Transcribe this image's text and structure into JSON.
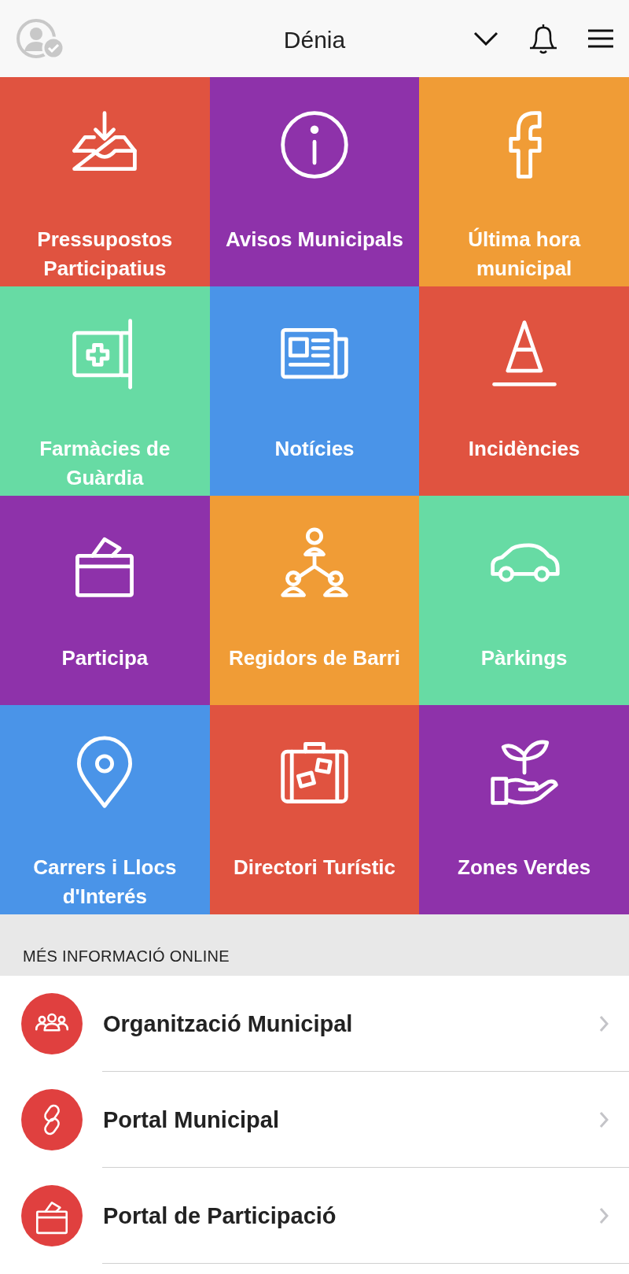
{
  "header": {
    "title": "Dénia"
  },
  "tiles": [
    {
      "label": "Pressupostos Participatius",
      "kind": "inbox",
      "color": "#e05340"
    },
    {
      "label": "Avisos Municipals",
      "kind": "info",
      "color": "#8e32aa"
    },
    {
      "label": "Última hora municipal",
      "kind": "facebook",
      "color": "#f09c36"
    },
    {
      "label": "Farmàcies de Guàrdia",
      "kind": "pharmacy",
      "color": "#67dba4"
    },
    {
      "label": "Notícies",
      "kind": "newspaper",
      "color": "#4a94e8"
    },
    {
      "label": "Incidències",
      "kind": "cone",
      "color": "#e05340"
    },
    {
      "label": "Participa",
      "kind": "ballot",
      "color": "#8e32aa"
    },
    {
      "label": "Regidors de Barri",
      "kind": "network",
      "color": "#f09c36"
    },
    {
      "label": "Pàrkings",
      "kind": "car",
      "color": "#67dba4"
    },
    {
      "label": "Carrers i Llocs d'Interés",
      "kind": "pin",
      "color": "#4a94e8"
    },
    {
      "label": "Directori Turístic",
      "kind": "suitcase",
      "color": "#e05340"
    },
    {
      "label": "Zones Verdes",
      "kind": "plant",
      "color": "#8e32aa"
    }
  ],
  "section": {
    "title": "MÉS INFORMACIÓ ONLINE"
  },
  "links": [
    {
      "label": "Organització Municipal",
      "kind": "people"
    },
    {
      "label": "Portal Municipal",
      "kind": "link"
    },
    {
      "label": "Portal de Participació",
      "kind": "ballot"
    }
  ]
}
